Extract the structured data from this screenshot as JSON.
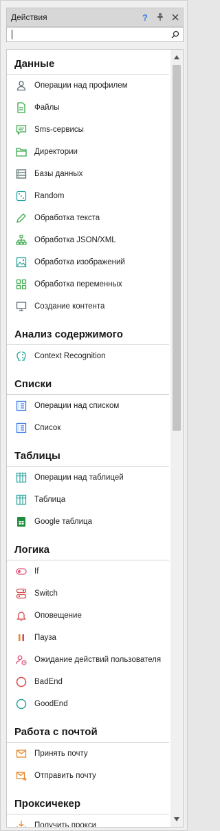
{
  "panel": {
    "title": "Действия",
    "help_label": "?",
    "pin_label": "⊥",
    "close_label": "✕",
    "search_placeholder": ""
  },
  "colors": {
    "green": "#3aa84a",
    "teal": "#2aa39c",
    "blue": "#3b7be6",
    "pink": "#e0507a",
    "orange": "#e8872b",
    "red": "#d8474a",
    "gray": "#5a6a72"
  },
  "sections": [
    {
      "title": "Данные",
      "items": [
        {
          "label": "Операции над профилем",
          "icon": "person-icon"
        },
        {
          "label": "Файлы",
          "icon": "file-icon"
        },
        {
          "label": "Sms-сервисы",
          "icon": "sms-icon"
        },
        {
          "label": "Директории",
          "icon": "folder-icon"
        },
        {
          "label": "Базы данных",
          "icon": "database-icon"
        },
        {
          "label": "Random",
          "icon": "dice-icon"
        },
        {
          "label": "Обработка текста",
          "icon": "pencil-icon"
        },
        {
          "label": "Обработка JSON/XML",
          "icon": "tree-icon"
        },
        {
          "label": "Обработка изображений",
          "icon": "image-icon"
        },
        {
          "label": "Обработка переменных",
          "icon": "grid-icon"
        },
        {
          "label": "Создание контента",
          "icon": "monitor-icon"
        }
      ]
    },
    {
      "title": "Анализ содержимого",
      "items": [
        {
          "label": "Context Recognition",
          "icon": "brain-icon"
        }
      ]
    },
    {
      "title": "Списки",
      "items": [
        {
          "label": "Операции над списком",
          "icon": "list-icon"
        },
        {
          "label": "Список",
          "icon": "list-icon"
        }
      ]
    },
    {
      "title": "Таблицы",
      "items": [
        {
          "label": "Операции над таблицей",
          "icon": "table-icon"
        },
        {
          "label": "Таблица",
          "icon": "table-icon"
        },
        {
          "label": "Google таблица",
          "icon": "google-sheet-icon"
        }
      ]
    },
    {
      "title": "Логика",
      "items": [
        {
          "label": "If",
          "icon": "toggle-icon"
        },
        {
          "label": "Switch",
          "icon": "switch-icon"
        },
        {
          "label": "Оповещение",
          "icon": "bell-icon"
        },
        {
          "label": "Пауза",
          "icon": "pause-icon"
        },
        {
          "label": "Ожидание действий пользователя",
          "icon": "user-wait-icon"
        },
        {
          "label": "BadEnd",
          "icon": "circle-red-icon"
        },
        {
          "label": "GoodEnd",
          "icon": "circle-green-icon"
        }
      ]
    },
    {
      "title": "Работа с почтой",
      "items": [
        {
          "label": "Принять почту",
          "icon": "mail-in-icon"
        },
        {
          "label": "Отправить почту",
          "icon": "mail-out-icon"
        }
      ]
    },
    {
      "title": "Проксичекер",
      "items": [
        {
          "label": "Получить прокси",
          "icon": "download-icon"
        }
      ]
    }
  ]
}
